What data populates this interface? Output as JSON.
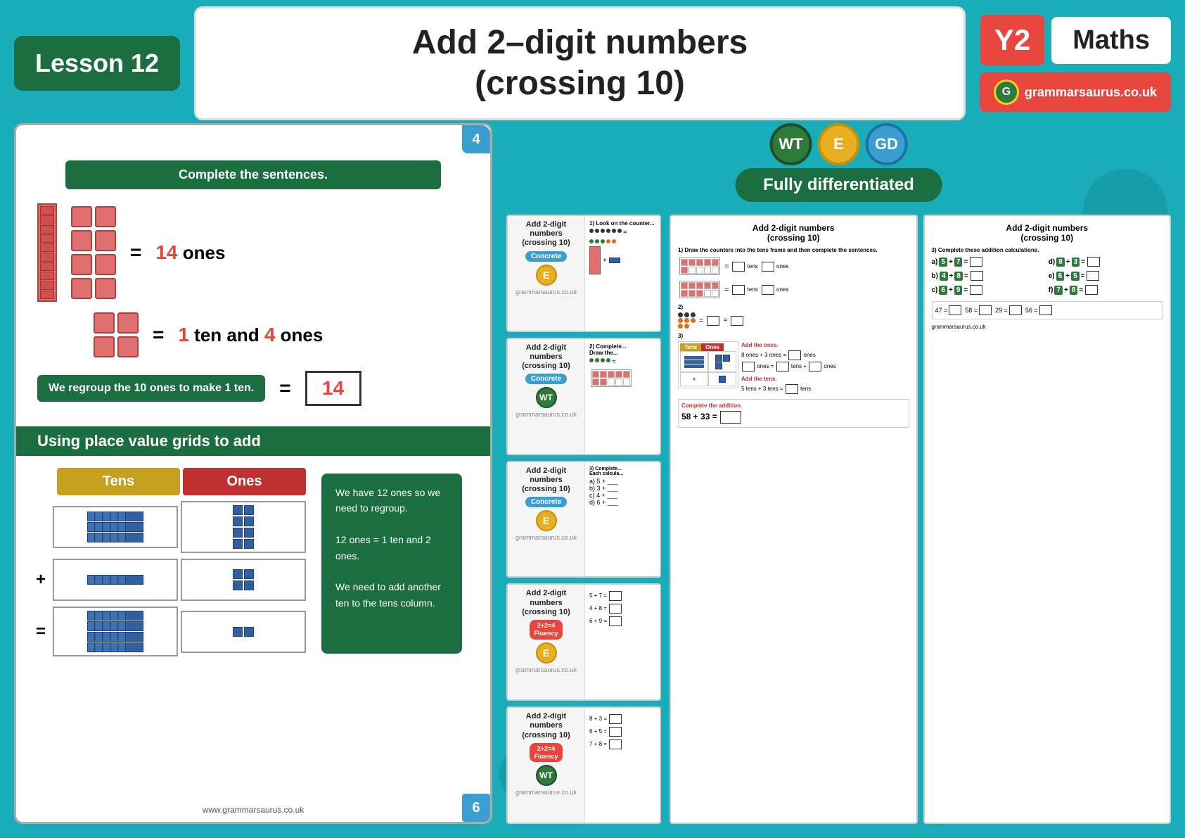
{
  "header": {
    "lesson_label": "Lesson 12",
    "title_line1": "Add 2–digit numbers",
    "title_line2": "(crossing 10)",
    "year_badge": "Y2",
    "maths_label": "Maths",
    "grammarsaurus_url": "grammarsaurus.co.uk",
    "grammarsaurus_logo": "G"
  },
  "left_panel": {
    "section1_heading": "Complete the sentences.",
    "ones_label": "= 14 ones",
    "ten_and_ones_label": "= 1 ten and 4 ones",
    "regroup_text": "We regroup the 10 ones to make 1 ten.",
    "regroup_result": "14",
    "section2_heading": "Using place value grids to add",
    "tens_header": "Tens",
    "ones_header": "Ones",
    "info_text_1": "We have 12 ones so we need to regroup.",
    "info_text_2": "12 ones = 1 ten and 2 ones.",
    "info_text_3": "We need to add another ten to the tens column.",
    "footer_url": "www.grammarsaurus.co.uk",
    "corner_number": "4",
    "corner_number2": "6"
  },
  "right_panel": {
    "wt_label": "WT",
    "e_label": "E",
    "gd_label": "GD",
    "fully_diff_label": "Fully differentiated",
    "worksheets": [
      {
        "title": "Add 2-digit numbers (crossing 10)",
        "badge": "Concrete",
        "level_badge": "E",
        "gram_label": "grammarsaurus.co.uk"
      },
      {
        "title": "Add 2-digit numbers (crossing 10)",
        "badge": "Concrete",
        "level_badge": "WT",
        "gram_label": "grammarsaurus.co.uk"
      },
      {
        "title": "Add 2-digit numbers (crossing 10)",
        "badge": "Concrete",
        "level_badge": "E",
        "gram_label": "grammarsaurus.co.uk"
      },
      {
        "title": "Add 2-digit numbers (crossing 10)",
        "badge": "Fluency",
        "level_badge": "E",
        "gram_label": "grammarsaurus.co.uk"
      },
      {
        "title": "Add 2-digit numbers (crossing 10)",
        "badge": "Fluency",
        "level_badge": "WT",
        "gram_label": "grammarsaurus.co.uk"
      }
    ],
    "large_ws_title": "Add 2-digit numbers (crossing 10)",
    "q1_label": "1) Look on the counter...",
    "q2_label": "2) Draw the counters...",
    "q3_label": "3)",
    "q3_sub": "3) Complete these addition calculations.",
    "tens_label": "Tens",
    "ones_label": "Ones",
    "add_ones_label": "Add the ones.",
    "add_tens_label": "Add the tens.",
    "complete_addition_label": "Complete the addition.",
    "eq1": "58 + 33 =",
    "eq2": "8 ones + 3 ones =",
    "eq3": "5 tens + 3 tens =",
    "calc_a": "a) 5 + 7 =",
    "calc_b": "b) 4 + 8 =",
    "calc_c": "c) 6 + 9 =",
    "calc_d": "d) 8 + 3 =",
    "calc_e": "e) 6 + 5 =",
    "calc_f": "f) 7 + 8 ="
  }
}
